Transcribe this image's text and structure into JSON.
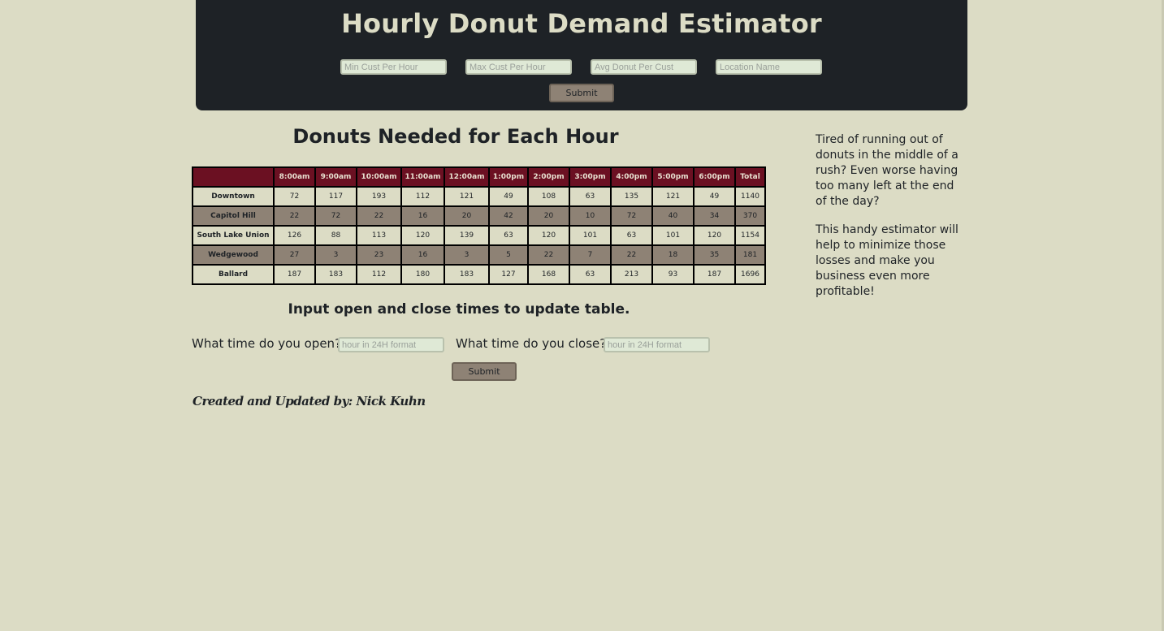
{
  "header": {
    "title": "Hourly Donut Demand Estimator",
    "inputs": {
      "min_cust": {
        "placeholder": "Min Cust Per Hour",
        "value": ""
      },
      "max_cust": {
        "placeholder": "Max Cust Per Hour",
        "value": ""
      },
      "avg_donut": {
        "placeholder": "Avg Donut Per Cust",
        "value": ""
      },
      "location": {
        "placeholder": "Location Name",
        "value": ""
      }
    },
    "submit_label": "Submit"
  },
  "main": {
    "table_title": "Donuts Needed for Each Hour",
    "table": {
      "columns": [
        "",
        "8:00am",
        "9:00am",
        "10:00am",
        "11:00am",
        "12:00am",
        "1:00pm",
        "2:00pm",
        "3:00pm",
        "4:00pm",
        "5:00pm",
        "6:00pm",
        "Total"
      ],
      "rows": [
        {
          "location": "Downtown",
          "values": [
            "72",
            "117",
            "193",
            "112",
            "121",
            "49",
            "108",
            "63",
            "135",
            "121",
            "49",
            "1140"
          ]
        },
        {
          "location": "Capitol Hill",
          "values": [
            "22",
            "72",
            "22",
            "16",
            "20",
            "42",
            "20",
            "10",
            "72",
            "40",
            "34",
            "370"
          ]
        },
        {
          "location": "South Lake Union",
          "values": [
            "126",
            "88",
            "113",
            "120",
            "139",
            "63",
            "120",
            "101",
            "63",
            "101",
            "120",
            "1154"
          ]
        },
        {
          "location": "Wedgewood",
          "values": [
            "27",
            "3",
            "23",
            "16",
            "3",
            "5",
            "22",
            "7",
            "22",
            "18",
            "35",
            "181"
          ]
        },
        {
          "location": "Ballard",
          "values": [
            "187",
            "183",
            "112",
            "180",
            "183",
            "127",
            "168",
            "63",
            "213",
            "93",
            "187",
            "1696"
          ]
        }
      ]
    },
    "update_title": "Input open and close times to update table.",
    "open_label": "What time do you open?",
    "open_placeholder": "hour in 24H format",
    "close_label": "What time do you close?",
    "close_placeholder": "hour in 24H format",
    "submit_label": "Submit",
    "credit": "Created and Updated by: Nick Kuhn"
  },
  "sidebar": {
    "paragraph1": "Tired of running out of donuts in the middle of a rush? Even worse having too many left at the end of the day?",
    "paragraph2": "This handy estimator will help to minimize those losses and make you business even more profitable!"
  },
  "colors": {
    "background": "#dcdcc5",
    "header_bg": "#1e2226",
    "table_header": "#6b1022",
    "row_dark": "#8e8275",
    "button": "#8e8275"
  }
}
